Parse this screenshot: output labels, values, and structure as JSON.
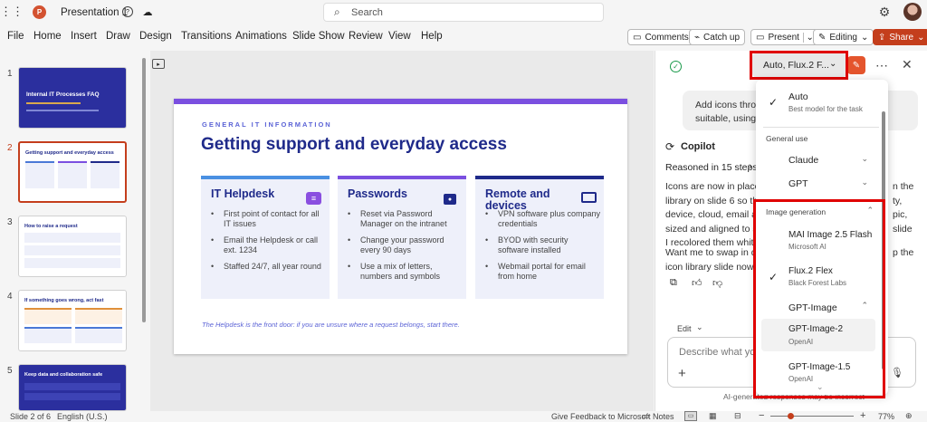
{
  "titlebar": {
    "doc_title": "Presentation 1",
    "search_placeholder": "Search"
  },
  "menu": [
    "File",
    "Home",
    "Insert",
    "Draw",
    "Design",
    "Transitions",
    "Animations",
    "Slide Show",
    "Review",
    "View",
    "Help"
  ],
  "ribbon_right": {
    "comments": "Comments",
    "catchup": "Catch up",
    "present": "Present",
    "editing": "Editing",
    "share": "Share"
  },
  "thumbnails": [
    {
      "num": "1",
      "title": "Internal IT Processes FAQ"
    },
    {
      "num": "2",
      "title": "Getting support and everyday access"
    },
    {
      "num": "3",
      "title": "How to raise a request"
    },
    {
      "num": "4",
      "title": "If something goes wrong, act fast"
    },
    {
      "num": "5",
      "title": "Keep data and collaboration safe"
    }
  ],
  "slide": {
    "eyebrow": "GENERAL IT INFORMATION",
    "title": "Getting support and everyday access",
    "cards": [
      {
        "title": "IT Helpdesk",
        "items": [
          "First point of contact for all IT issues",
          "Email the Helpdesk or call ext. 1234",
          "Staffed 24/7, all year round"
        ]
      },
      {
        "title": "Passwords",
        "items": [
          "Reset via Password Manager on the intranet",
          "Change your password every 90 days",
          "Use a mix of letters, numbers and symbols"
        ]
      },
      {
        "title": "Remote and devices",
        "items": [
          "VPN software plus company credentials",
          "BYOD with security software installed",
          "Webmail portal for email from home"
        ]
      }
    ],
    "footer": "The Helpdesk is the front door: if you are unsure where a request belongs, start there."
  },
  "copilot": {
    "model_selector": "Auto, Flux.2 F...",
    "user_msg_line1": "Add icons throu",
    "user_msg_line2": "suitable, using t",
    "copilot_label": "Copilot",
    "reasoned": "Reasoned in 15 steps",
    "body_lines": [
      "Icons are now in place ac",
      "library on slide 6 so the",
      "device, cloud, email and",
      "sized and aligned to sit",
      "I recolored them whites"
    ],
    "body_right": [
      "n the",
      "ty,",
      "pic,",
      "slide"
    ],
    "body2_lines": [
      "Want me to swap in diffe",
      "icon library slide now t"
    ],
    "body2_right": [
      "p the"
    ],
    "edit_label": "Edit",
    "input_placeholder": "Describe what you'l",
    "disclaimer": "AI-generated responses may be incorrect"
  },
  "model_menu": {
    "auto": {
      "title": "Auto",
      "sub": "Best model for the task"
    },
    "general_use": "General use",
    "claude": "Claude",
    "gpt": "GPT",
    "image_generation": "Image generation",
    "mai": {
      "title": "MAI Image 2.5 Flash",
      "sub": "Microsoft AI"
    },
    "flux": {
      "title": "Flux.2 Flex",
      "sub": "Black Forest Labs"
    },
    "gpt_image": "GPT-Image",
    "gpt_image_2": {
      "title": "GPT-Image-2",
      "sub": "OpenAI"
    },
    "gpt_image_15": {
      "title": "GPT-Image-1.5",
      "sub": "OpenAI"
    }
  },
  "status": {
    "slide_count": "Slide 2 of 6",
    "language": "English (U.S.)",
    "feedback": "Give Feedback to Microsoft",
    "notes": "Notes",
    "zoom": "77%"
  },
  "colors": {
    "accent": "#c43e1c",
    "slide_blue": "#1f2a8a",
    "purple": "#7b4fe0",
    "highlight": "#e00000"
  }
}
